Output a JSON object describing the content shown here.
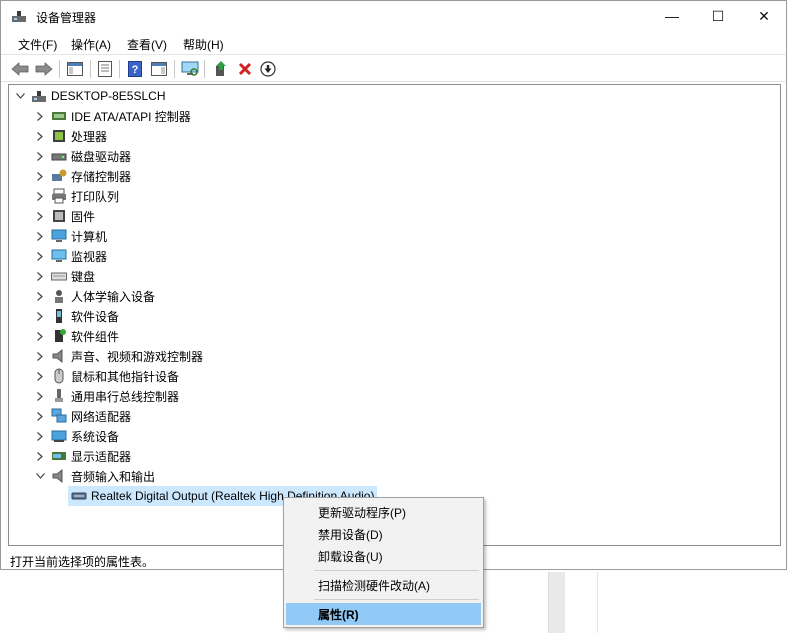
{
  "window": {
    "title": "设备管理器",
    "controls": {
      "minimize": "—",
      "maximize": "☐",
      "close": "✕"
    }
  },
  "menu": [
    "文件(F)",
    "操作(A)",
    "查看(V)",
    "帮助(H)"
  ],
  "toolbar": [
    "back-arrow",
    "forward-arrow",
    "show-hide-console-tree",
    "properties",
    "help",
    "action-pane",
    "scan-hardware",
    "update-driver",
    "uninstall",
    "disable"
  ],
  "tree": {
    "root": "DESKTOP-8E5SLCH",
    "categories": [
      {
        "label": "IDE ATA/ATAPI 控制器",
        "icon": "ide-controller-icon"
      },
      {
        "label": "处理器",
        "icon": "processor-icon"
      },
      {
        "label": "磁盘驱动器",
        "icon": "disk-drive-icon"
      },
      {
        "label": "存储控制器",
        "icon": "storage-controller-icon"
      },
      {
        "label": "打印队列",
        "icon": "printer-icon"
      },
      {
        "label": "固件",
        "icon": "firmware-icon"
      },
      {
        "label": "计算机",
        "icon": "computer-icon"
      },
      {
        "label": "监视器",
        "icon": "monitor-icon"
      },
      {
        "label": "键盘",
        "icon": "keyboard-icon"
      },
      {
        "label": "人体学输入设备",
        "icon": "hid-icon"
      },
      {
        "label": "软件设备",
        "icon": "software-device-icon"
      },
      {
        "label": "软件组件",
        "icon": "software-component-icon"
      },
      {
        "label": "声音、视频和游戏控制器",
        "icon": "speaker-icon"
      },
      {
        "label": "鼠标和其他指针设备",
        "icon": "mouse-icon"
      },
      {
        "label": "通用串行总线控制器",
        "icon": "usb-icon"
      },
      {
        "label": "网络适配器",
        "icon": "network-icon"
      },
      {
        "label": "系统设备",
        "icon": "system-device-icon"
      },
      {
        "label": "显示适配器",
        "icon": "display-adapter-icon"
      },
      {
        "label": "音频输入和输出",
        "icon": "audio-io-icon"
      }
    ],
    "selected_child": "Realtek Digital Output (Realtek High Definition Audio)"
  },
  "status": "打开当前选择项的属性表。",
  "context_menu": {
    "items": [
      "更新驱动程序(P)",
      "禁用设备(D)",
      "卸载设备(U)",
      "扫描检测硬件改动(A)",
      "属性(R)"
    ],
    "highlighted": "属性(R)"
  },
  "colors": {
    "selection": "#cce8ff",
    "menu_highlight": "#91c9f7",
    "uninstall_red": "#d42020"
  }
}
